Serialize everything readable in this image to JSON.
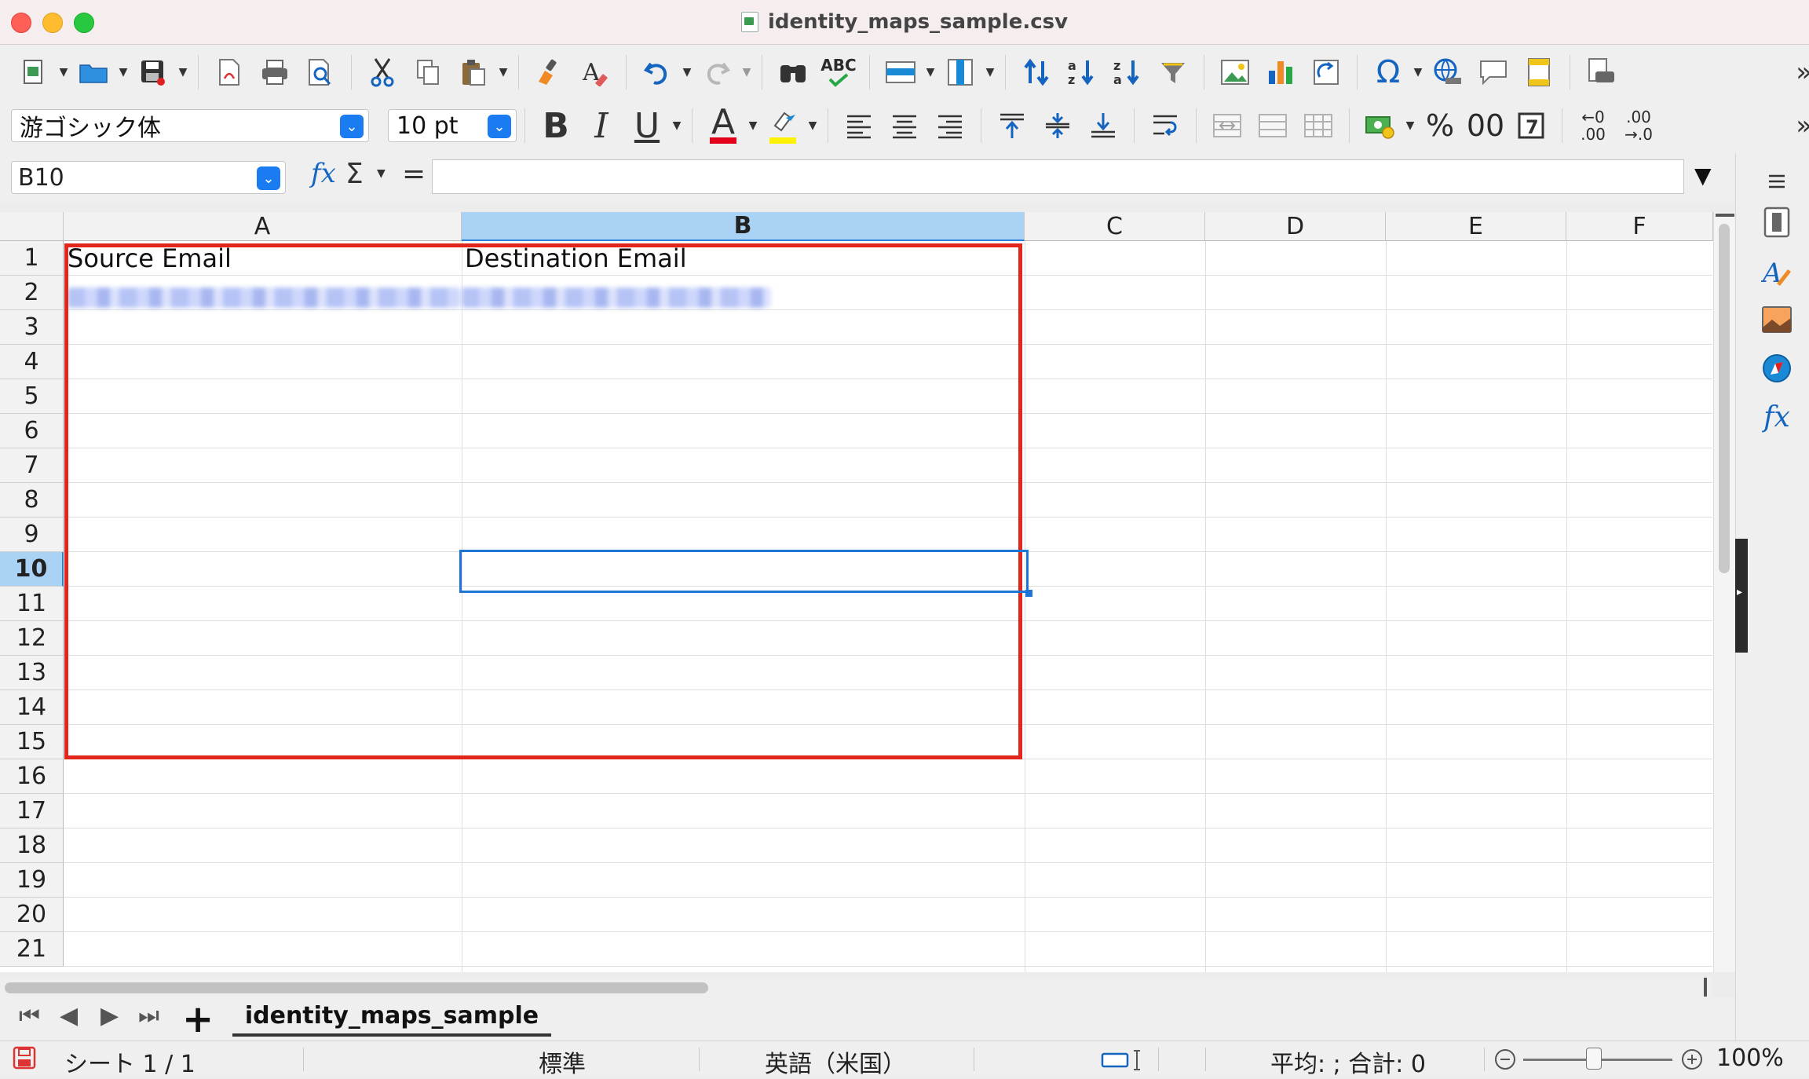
{
  "window": {
    "title": "identity_maps_sample.csv"
  },
  "font": {
    "name": "游ゴシック体",
    "size": "10 pt"
  },
  "toolbar_glyphs": {
    "spellcheck": "ABC",
    "special_char": "Ω",
    "percent": "%",
    "decimals": "00",
    "add_decimal_top": "←0",
    "add_decimal_bottom": ".00",
    "del_decimal_top": ".00",
    "del_decimal_bottom": "→.0",
    "bold": "B",
    "italic": "I",
    "underline": "U",
    "font_color": "A",
    "overflow": "»"
  },
  "formula_bar": {
    "cell_ref": "B10",
    "fx": "fx",
    "sum": "Σ",
    "equals": "=",
    "content": ""
  },
  "sheet": {
    "columns": [
      "A",
      "B",
      "C",
      "D",
      "E",
      "F"
    ],
    "selected_column": "B",
    "rows": [
      "1",
      "2",
      "3",
      "4",
      "5",
      "6",
      "7",
      "8",
      "9",
      "10",
      "11",
      "12",
      "13",
      "14",
      "15",
      "16",
      "17",
      "18",
      "19",
      "20",
      "21"
    ],
    "selected_row": "10",
    "cells": {
      "A1": "Source Email",
      "B1": "Destination Email"
    }
  },
  "sheet_tabs": {
    "add": "+",
    "active_tab": "identity_maps_sample"
  },
  "status": {
    "sheet_position": "シート 1 / 1",
    "page_style": "標準",
    "language": "英語（米国）",
    "summary": "平均: ; 合計: 0",
    "zoom": "100%"
  },
  "colors": {
    "annotation_border": "#e3261c",
    "selection": "#1d75d6",
    "header_selected": "#a9d2f5",
    "combo_button": "#1b7cf2"
  }
}
